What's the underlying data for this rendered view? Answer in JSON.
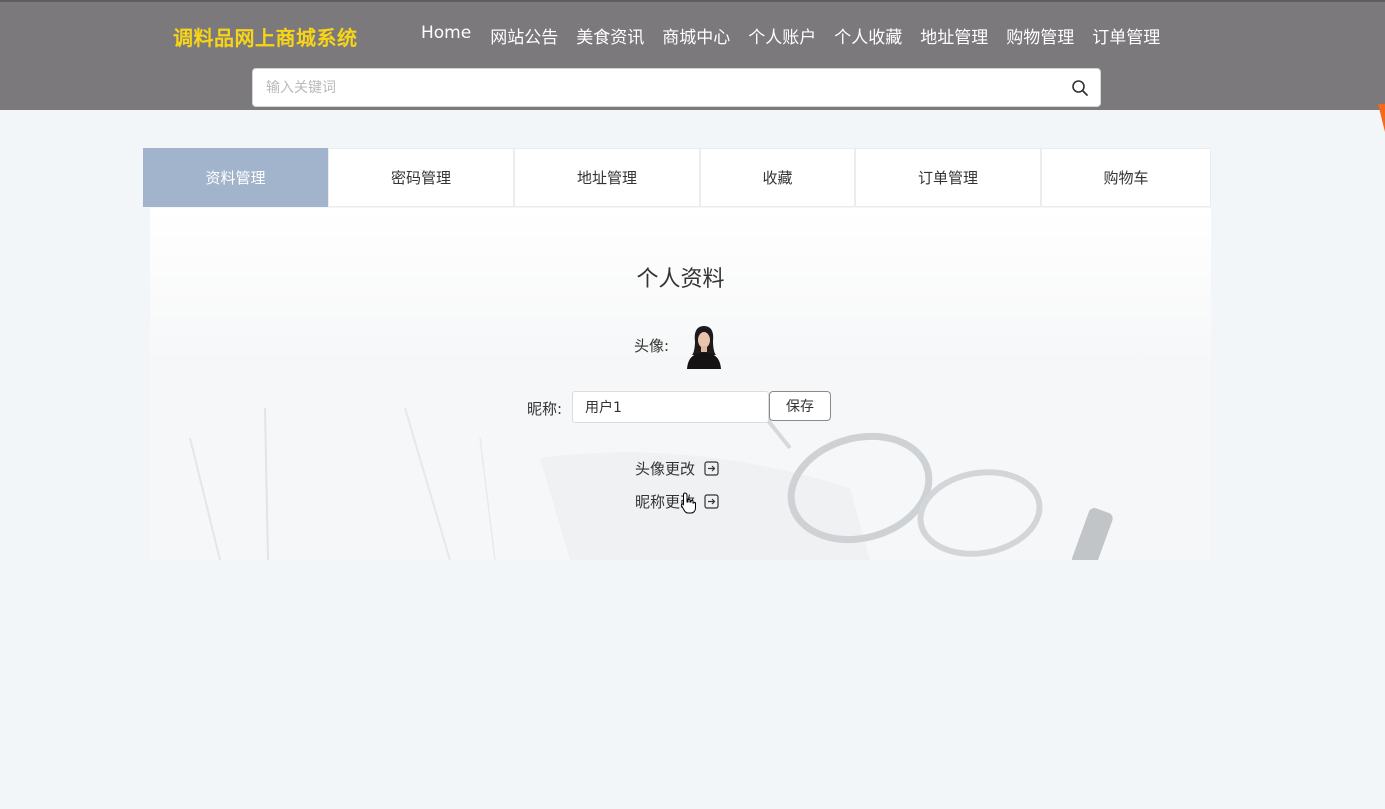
{
  "header": {
    "logo": "调料品网上商城系统",
    "nav": [
      {
        "label": "Home"
      },
      {
        "label": "网站公告"
      },
      {
        "label": "美食资讯"
      },
      {
        "label": "商城中心"
      },
      {
        "label": "个人账户"
      },
      {
        "label": "个人收藏"
      },
      {
        "label": "地址管理"
      },
      {
        "label": "购物管理"
      },
      {
        "label": "订单管理"
      }
    ],
    "search": {
      "placeholder": "输入关键词",
      "value": "",
      "icon": "search-icon"
    }
  },
  "tabs": [
    {
      "label": "资料管理",
      "active": true
    },
    {
      "label": "密码管理",
      "active": false
    },
    {
      "label": "地址管理",
      "active": false
    },
    {
      "label": "收藏",
      "active": false
    },
    {
      "label": "订单管理",
      "active": false
    },
    {
      "label": "购物车",
      "active": false
    }
  ],
  "profile": {
    "title": "个人资料",
    "avatar_label": "头像:",
    "nickname_label": "昵称:",
    "nickname_value": "用户1",
    "save_label": "保存",
    "links": [
      {
        "label": "头像更改",
        "icon": "arrow-right-box-icon"
      },
      {
        "label": "昵称更改",
        "icon": "arrow-right-box-icon"
      }
    ]
  },
  "colors": {
    "header_bg": "#7b797b",
    "logo": "#f7d417",
    "active_tab": "#a2b4cb",
    "page_bg": "#f3f6f9",
    "corner_accent": "#f26b1d"
  }
}
